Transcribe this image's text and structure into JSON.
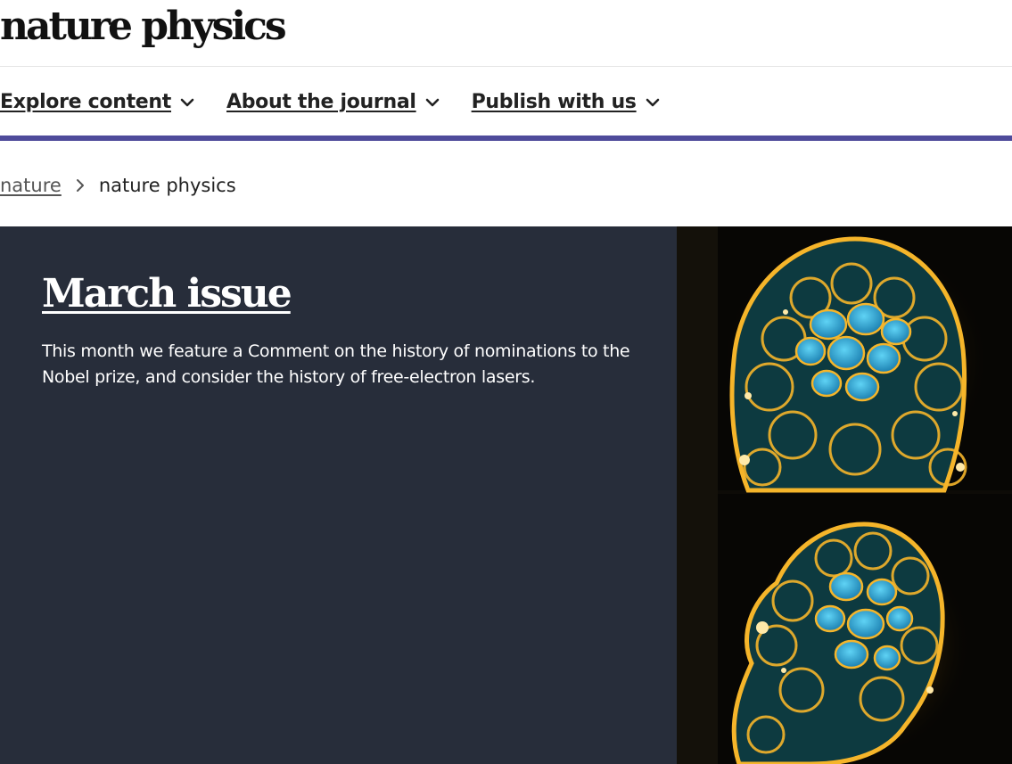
{
  "header": {
    "logo_text": "nature physics"
  },
  "nav": {
    "items": [
      {
        "label": "Explore content",
        "icon": "chevron-down-icon"
      },
      {
        "label": "About the journal",
        "icon": "chevron-down-icon"
      },
      {
        "label": "Publish with us",
        "icon": "chevron-down-icon"
      }
    ]
  },
  "breadcrumb": {
    "parent": "nature",
    "separator_icon": "chevron-right-icon",
    "current": "nature physics"
  },
  "hero": {
    "title": "March issue",
    "description": "This month we feature a Comment on the history of nominations to the Nobel prize, and consider the history of free-electron lasers.",
    "image_subject": "fluorescence micrograph of two embryos"
  },
  "colors": {
    "accent_bar": "#4f4b9b",
    "hero_background": "#272d3a",
    "membrane_stain": "#f5b52a",
    "nucleus_stain": "#2aa7d6"
  }
}
